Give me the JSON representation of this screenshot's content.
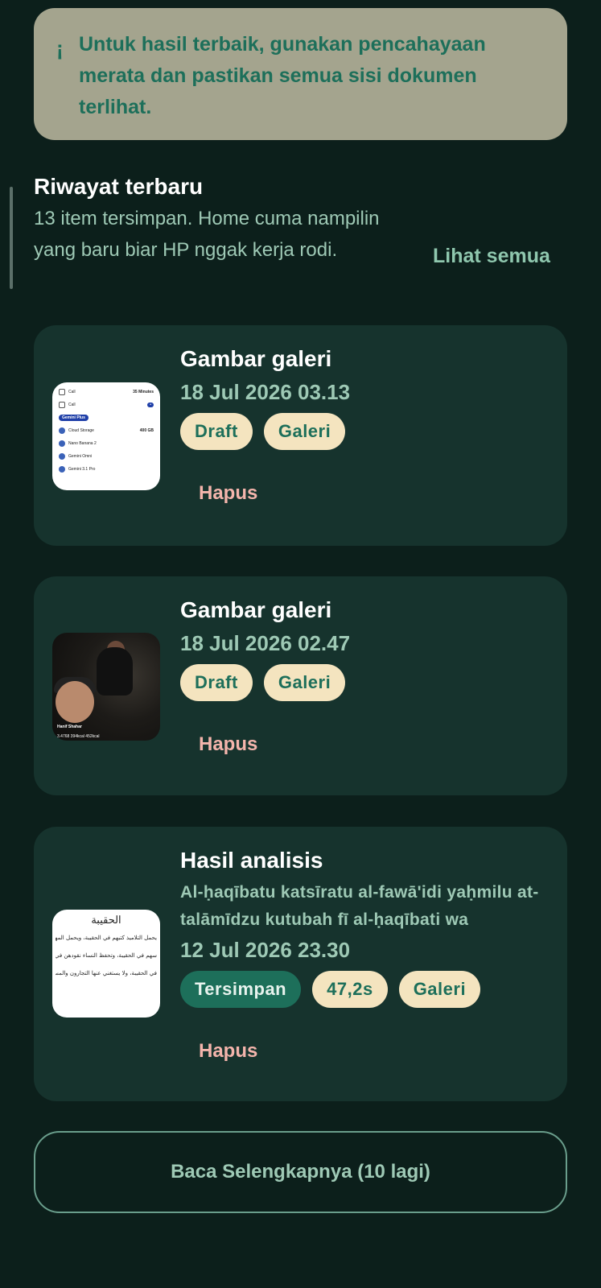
{
  "tip": {
    "icon": "info-icon",
    "text": "Untuk hasil terbaik, gunakan pencahayaan merata dan pastikan semua sisi dokumen terlihat."
  },
  "history": {
    "title": "Riwayat terbaru",
    "subtitle": "13 item tersimpan. Home cuma nampilin yang baru biar HP nggak kerja rodi.",
    "see_all_label": "Lihat semua"
  },
  "items": [
    {
      "title": "Gambar galeri",
      "date": "18 Jul 2026 03.13",
      "chips": [
        "Draft",
        "Galeri"
      ],
      "delete_label": "Hapus",
      "thumbnail": {
        "rows": [
          "Call",
          "Call",
          "Gemini Plus",
          "Cloud Storage",
          "Nano Banana 2",
          "Gemini Omni",
          "Gemini 3.1 Pro"
        ],
        "values": {
          "minutes": "35 Minutes",
          "storage": "400 GB"
        }
      }
    },
    {
      "title": "Gambar galeri",
      "date": "18 Jul 2026 02.47",
      "chips": [
        "Draft",
        "Galeri"
      ],
      "delete_label": "Hapus",
      "thumbnail": {
        "caption_name": "Hanif Shahar",
        "caption_stats": "3.4768   394kcal   452kcal"
      }
    },
    {
      "title": "Hasil analisis",
      "preview": "Al-ḥaqībatu katsīratu al-fawā'idi yaḥmilu at-talāmīdzu kutubah fī al-ḥaqībati wa",
      "date": "12 Jul 2026 23.30",
      "chips": [
        "Tersimpan",
        "47,2s",
        "Galeri"
      ],
      "delete_label": "Hapus",
      "thumbnail": {
        "doc_title": "الحقيبة",
        "doc_lines": [
          "يحمل التلاميذ كتبهم في الحقيبة، ويحمل المهندس",
          "سهم في الحقيبة، وتحفظ النساء نقودهن في الحقيبة",
          "في الحقيبة، ولا يستغني عنها التجارون والمسافرون"
        ]
      }
    }
  ],
  "more_button_label": "Baca Selengkapnya (10 lagi)",
  "colors": {
    "background": "#0c1f1b",
    "card": "#16332d",
    "tip_bg": "#a4a48e",
    "accent": "#1d6f5a",
    "chip_bg": "#f4e4bf",
    "delete": "#f4b5ac"
  }
}
